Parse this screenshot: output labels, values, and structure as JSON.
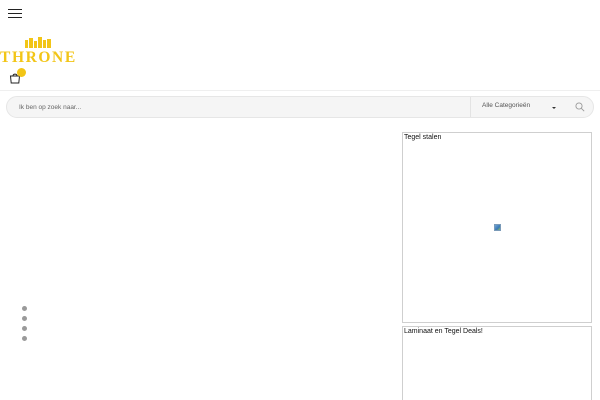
{
  "header": {
    "menu_icon": "hamburger-menu-icon",
    "logo": {
      "text": "THRONE",
      "icon": "castle-crown-icon",
      "color": "#f2c517"
    },
    "cart": {
      "icon": "shopping-bag-icon",
      "badge_color": "#f2c517"
    }
  },
  "search": {
    "placeholder": "Ik ben op zoek naar...",
    "category_label": "Alle Categorieën",
    "icon": "search-icon"
  },
  "slider": {
    "dots": 4
  },
  "cards": [
    {
      "title": "Tegel stalen",
      "image_icon": "broken-image-icon"
    },
    {
      "title": "Laminaat en Tegel Deals!"
    }
  ],
  "colors": {
    "accent": "#f2c517",
    "search_bg": "#f5f5f5",
    "card_border": "#cfcfcf"
  }
}
